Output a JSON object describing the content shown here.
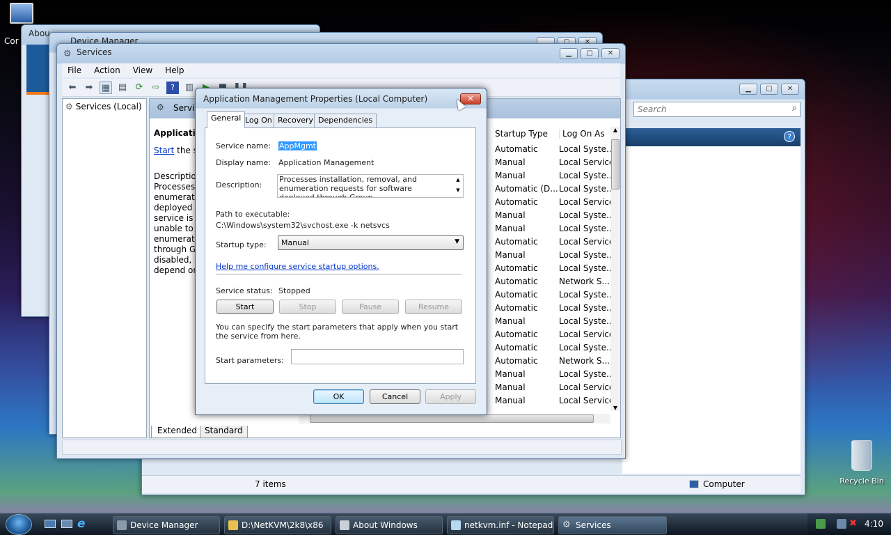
{
  "desktop": {
    "computer_label": "Cor",
    "recycle_label": "Recycle Bin"
  },
  "bg_windows": {
    "about_title": "Abou",
    "devmgr_title": "Device Manager"
  },
  "explorer": {
    "search_placeholder": "Search",
    "status_items": "7 items",
    "status_location": "Computer"
  },
  "services": {
    "title": "Services",
    "menu": [
      "File",
      "Action",
      "View",
      "Help"
    ],
    "tree_item": "Services (Local)",
    "header_title": "Servic",
    "left_pane": {
      "heading": "Application",
      "start_link": "Start",
      "start_rest": "the ser",
      "desc_lines": [
        "Description",
        "Processes in",
        "enumeration",
        "deployed th",
        "service is di",
        "unable to in",
        "enumerate",
        "through Gro",
        "disabled, an",
        "depend on"
      ]
    },
    "columns": [
      "Startup Type",
      "Log On As"
    ],
    "rows": [
      [
        "Automatic",
        "Local Syste..."
      ],
      [
        "Manual",
        "Local Service"
      ],
      [
        "Manual",
        "Local Syste..."
      ],
      [
        "Automatic (D...",
        "Local Syste..."
      ],
      [
        "Automatic",
        "Local Service"
      ],
      [
        "Manual",
        "Local Syste..."
      ],
      [
        "Manual",
        "Local Syste..."
      ],
      [
        "Automatic",
        "Local Service"
      ],
      [
        "Manual",
        "Local Syste..."
      ],
      [
        "Automatic",
        "Local Syste..."
      ],
      [
        "Automatic",
        "Network S..."
      ],
      [
        "Automatic",
        "Local Syste..."
      ],
      [
        "Automatic",
        "Local Syste..."
      ],
      [
        "Manual",
        "Local Syste..."
      ],
      [
        "Automatic",
        "Local Service"
      ],
      [
        "Automatic",
        "Local Syste..."
      ],
      [
        "Automatic",
        "Network S..."
      ],
      [
        "Manual",
        "Local Syste..."
      ],
      [
        "Manual",
        "Local Service"
      ],
      [
        "Manual",
        "Local Service"
      ]
    ],
    "tabs": [
      "Extended",
      "Standard"
    ]
  },
  "dialog": {
    "title": "Application Management Properties (Local Computer)",
    "tabs": [
      "General",
      "Log On",
      "Recovery",
      "Dependencies"
    ],
    "service_name_label": "Service name:",
    "service_name": "AppMgmt",
    "display_name_label": "Display name:",
    "display_name": "Application Management",
    "description_label": "Description:",
    "description": "Processes installation, removal, and enumeration requests for software deployed through Group",
    "path_label": "Path to executable:",
    "path": "C:\\Windows\\system32\\svchost.exe -k netsvcs",
    "startup_type_label": "Startup type:",
    "startup_type": "Manual",
    "help_link": "Help me configure service startup options.",
    "status_label": "Service status:",
    "status": "Stopped",
    "start": "Start",
    "stop": "Stop",
    "pause": "Pause",
    "resume": "Resume",
    "params_note": "You can specify the start parameters that apply when you start the service from here.",
    "params_label": "Start parameters:",
    "params_value": "",
    "ok": "OK",
    "cancel": "Cancel",
    "apply": "Apply"
  },
  "taskbar": {
    "items": [
      "Device Manager",
      "D:\\NetKVM\\2k8\\x86",
      "About Windows",
      "netkvm.inf - Notepad",
      "Services"
    ],
    "clock": "4:10"
  },
  "colors": {
    "link": "#0033cc",
    "selection": "#3399ff",
    "taskbar": "#1c2a38"
  }
}
